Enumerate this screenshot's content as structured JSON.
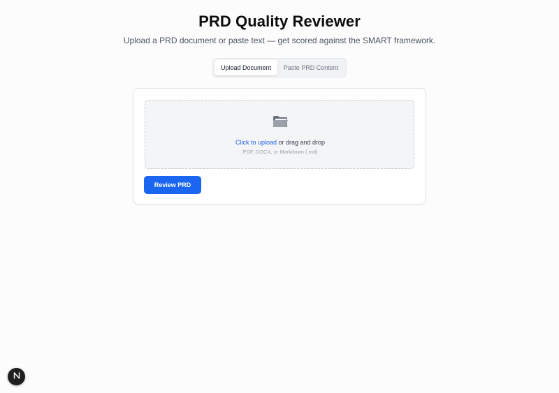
{
  "header": {
    "title": "PRD Quality Reviewer",
    "subtitle": "Upload a PRD document or paste text — get scored against the SMART framework."
  },
  "tabs": [
    {
      "label": "Upload Document",
      "active": true
    },
    {
      "label": "Paste PRD Content",
      "active": false
    }
  ],
  "upload": {
    "icon": "folder-icon",
    "link_text": "Click to upload",
    "rest_text": " or drag and drop",
    "hint": "PDF, DOCX, or Markdown (.md)"
  },
  "actions": {
    "review_label": "Review PRD"
  },
  "dev_badge": {
    "icon": "n-logo-icon"
  },
  "colors": {
    "accent": "#1a66f0",
    "link": "#2563eb",
    "background": "#fcfcfc"
  }
}
